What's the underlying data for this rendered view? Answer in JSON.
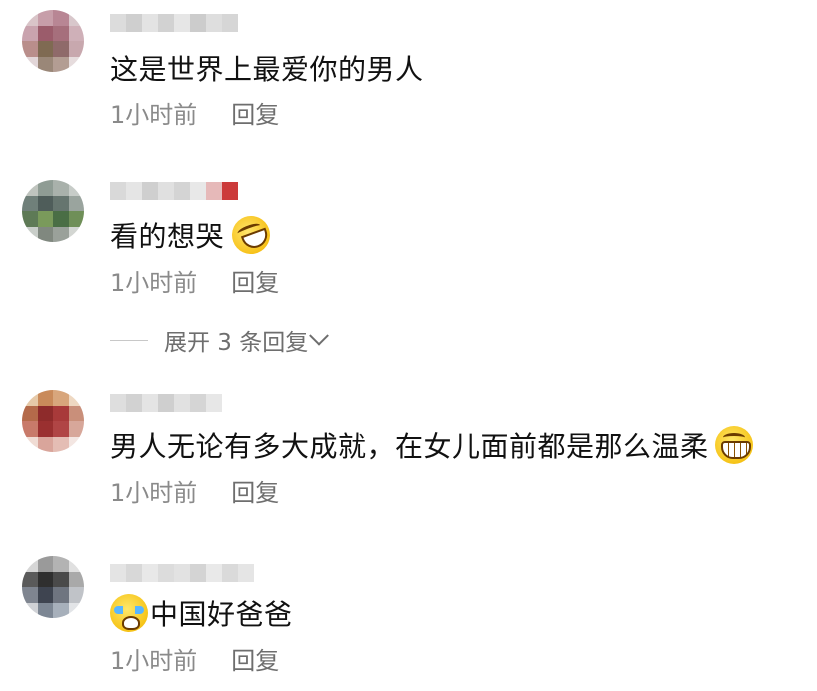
{
  "comments": [
    {
      "text": "这是世界上最爱你的男人",
      "time": "1小时前",
      "reply_label": "回复"
    },
    {
      "text": "看的想哭",
      "emoji_icon": "laughing-tears-emoji-icon",
      "time": "1小时前",
      "reply_label": "回复"
    },
    {
      "text": "男人无论有多大成就，在女儿面前都是那么温柔",
      "emoji_icon": "grinning-emoji-icon",
      "time": "1小时前",
      "reply_label": "回复"
    },
    {
      "text": "中国好爸爸",
      "emoji_icon": "crying-emoji-icon",
      "time": "1小时前",
      "reply_label": "回复"
    }
  ],
  "expand_replies": {
    "label": "展开 3 条回复"
  },
  "colors": {
    "meta_text": "#8a8a8a",
    "reply_text": "#6e6e6e",
    "body_text": "#111111"
  }
}
